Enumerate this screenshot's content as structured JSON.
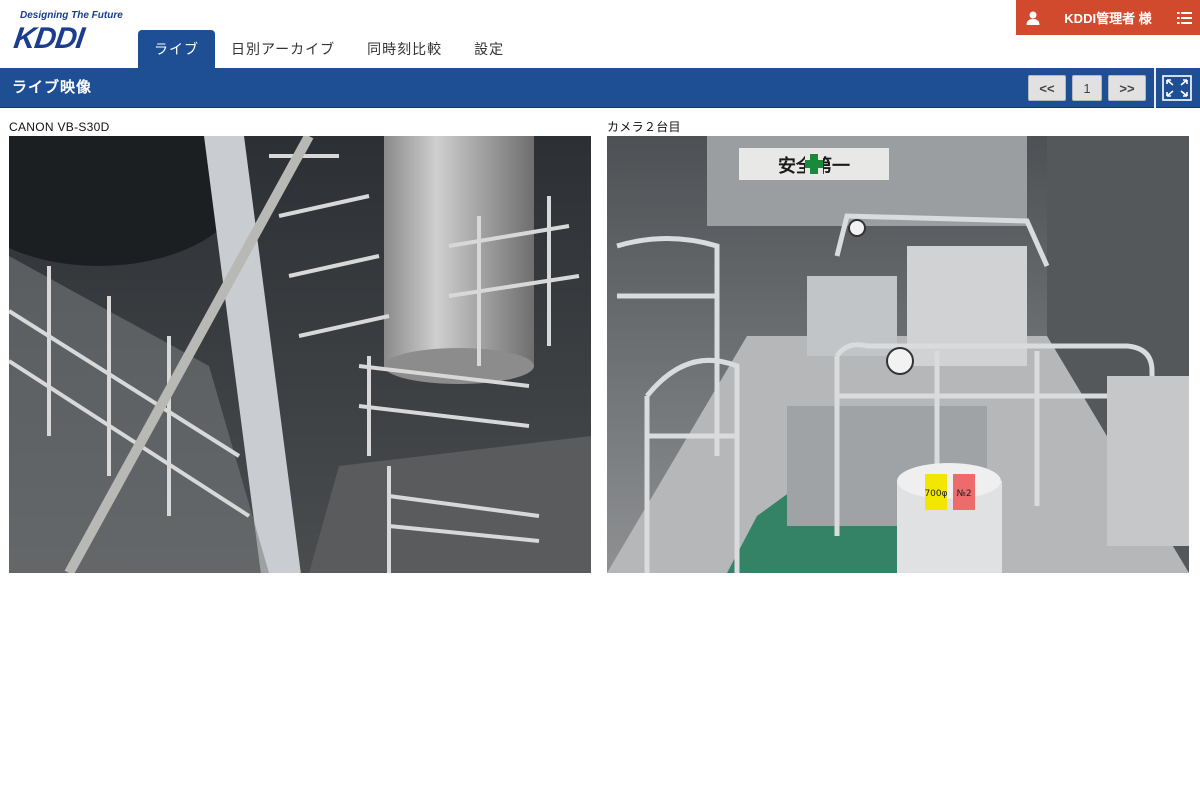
{
  "brand": {
    "tagline": "Designing The Future",
    "name": "KDDI"
  },
  "tabs": [
    {
      "label": "ライブ",
      "active": true
    },
    {
      "label": "日別アーカイブ",
      "active": false
    },
    {
      "label": "同時刻比較",
      "active": false
    },
    {
      "label": "設定",
      "active": false
    }
  ],
  "user": {
    "name": "KDDI管理者 様",
    "icon": "user-icon",
    "menu_icon": "list-menu-icon",
    "color": "#d24a2e"
  },
  "bar": {
    "title": "ライブ映像",
    "color": "#1e4f95",
    "prev_label": "<<",
    "page": "1",
    "next_label": ">>",
    "fullscreen_icon": "fullscreen-icon"
  },
  "cameras": [
    {
      "name": "CANON VB-S30D",
      "scene": "industrial staircase and tank (live feed)"
    },
    {
      "name": "カメラ２台目",
      "scene": "machinery floor with railings (live feed)",
      "sign_text": "安全第一",
      "tag_text": "700φ",
      "tag_no": "№2"
    }
  ]
}
